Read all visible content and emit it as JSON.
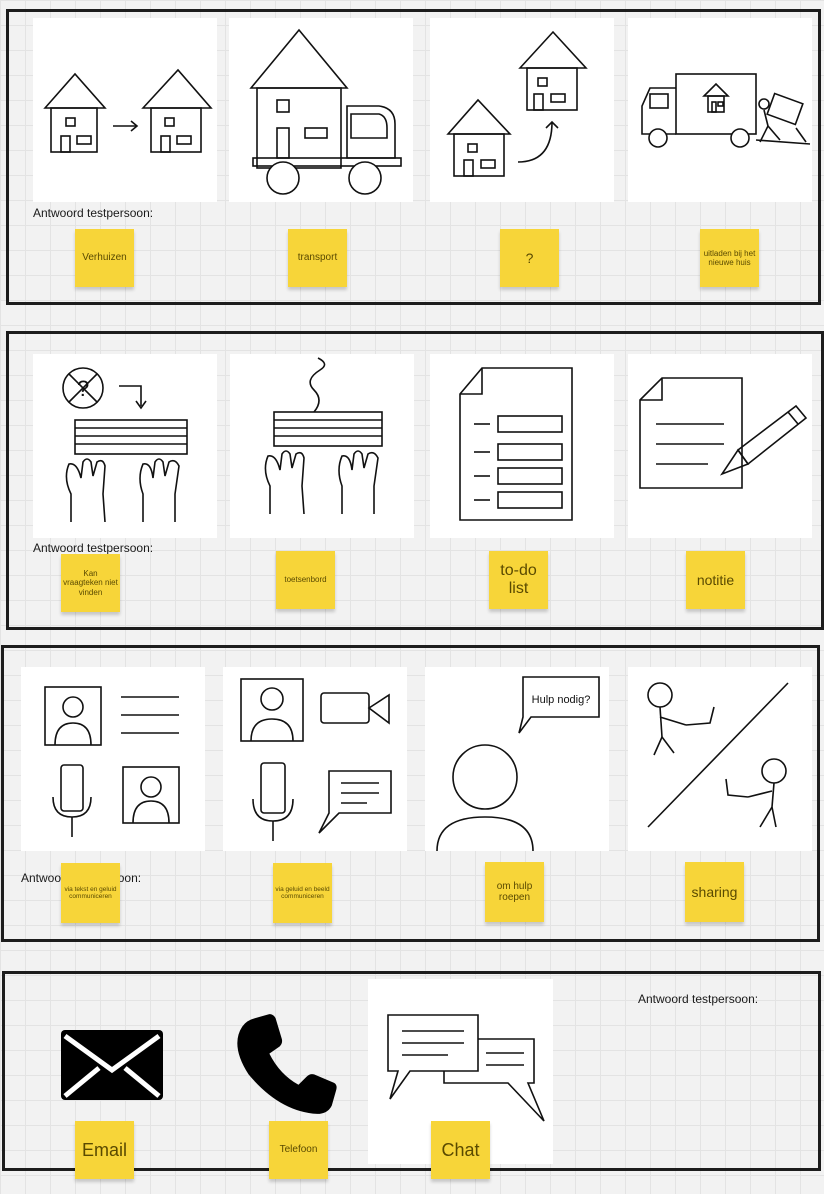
{
  "answer_label": "Antwoord testpersoon:",
  "sections": [
    {
      "cards": [
        {
          "icon": "house-to-house-icon",
          "note": "Verhuizen"
        },
        {
          "icon": "house-on-truck-icon",
          "note": "transport"
        },
        {
          "icon": "house-arrow-up-icon",
          "note": "?"
        },
        {
          "icon": "moving-truck-unload-icon",
          "note": "uitladen bij het nieuwe huis"
        }
      ]
    },
    {
      "cards": [
        {
          "icon": "keyboard-question-icon",
          "note": "Kan vraagteken niet vinden"
        },
        {
          "icon": "keyboard-hands-icon",
          "note": "toetsenbord"
        },
        {
          "icon": "todo-list-icon",
          "note": "to-do list"
        },
        {
          "icon": "note-pencil-icon",
          "note": "notitie"
        }
      ]
    },
    {
      "cards": [
        {
          "icon": "text-communication-icon",
          "note": "via tekst en geluid communiceren"
        },
        {
          "icon": "video-communication-icon",
          "note": "via geluid en beeld communiceren"
        },
        {
          "icon": "help-bubble-icon",
          "bubble": "Hulp nodig?",
          "note": "om hulp roepen"
        },
        {
          "icon": "sharing-people-icon",
          "note": "sharing"
        }
      ]
    },
    {
      "cards": [
        {
          "icon": "envelope-icon",
          "note": "Email"
        },
        {
          "icon": "phone-icon",
          "note": "Telefoon"
        },
        {
          "icon": "chat-bubbles-icon",
          "note": "Chat"
        }
      ]
    }
  ],
  "colors": {
    "sticky": "#f7d539",
    "frame": "#1d1d1d",
    "background": "#f2f2f2"
  }
}
